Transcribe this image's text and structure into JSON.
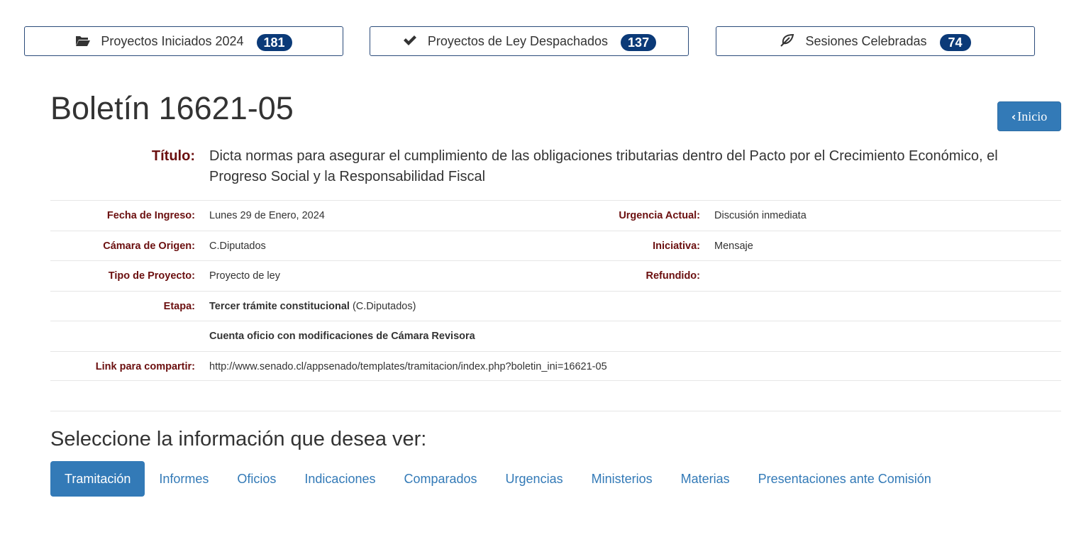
{
  "stats": [
    {
      "icon": "folder-open-icon",
      "label": "Proyectos Iniciados 2024",
      "count": "181"
    },
    {
      "icon": "checkmark-icon",
      "label": "Proyectos de Ley Despachados",
      "count": "137"
    },
    {
      "icon": "leaf-icon",
      "label": "Sesiones Celebradas",
      "count": "74"
    }
  ],
  "page_title": "Boletín 16621-05",
  "inicio_label": "Inicio",
  "titulo": {
    "label": "Título:",
    "text": "Dicta normas para asegurar el cumplimiento de las obligaciones tributarias dentro del Pacto por el Crecimiento Económico, el Progreso Social y la Responsabilidad Fiscal"
  },
  "info": {
    "fecha_ingreso": {
      "label": "Fecha de Ingreso:",
      "value": "Lunes 29 de Enero, 2024"
    },
    "urgencia_actual": {
      "label": "Urgencia Actual:",
      "value": "Discusión inmediata"
    },
    "camara_origen": {
      "label": "Cámara de Origen:",
      "value": "C.Diputados"
    },
    "iniciativa": {
      "label": "Iniciativa:",
      "value": "Mensaje"
    },
    "tipo_proyecto": {
      "label": "Tipo de Proyecto:",
      "value": "Proyecto de ley"
    },
    "refundido": {
      "label": "Refundido:",
      "value": ""
    },
    "etapa": {
      "label": "Etapa:",
      "value_bold": "Tercer trámite constitucional",
      "value_rest": " (C.Diputados)"
    },
    "subetapa": {
      "value": "Cuenta oficio con modificaciones de Cámara Revisora"
    },
    "link": {
      "label": "Link para compartir:",
      "value": "http://www.senado.cl/appsenado/templates/tramitacion/index.php?boletin_ini=16621-05"
    }
  },
  "section_title": "Seleccione la información que desea ver:",
  "tabs": [
    {
      "label": "Tramitación",
      "active": true
    },
    {
      "label": "Informes"
    },
    {
      "label": "Oficios"
    },
    {
      "label": "Indicaciones"
    },
    {
      "label": "Comparados"
    },
    {
      "label": "Urgencias"
    },
    {
      "label": "Ministerios"
    },
    {
      "label": "Materias"
    },
    {
      "label": "Presentaciones ante Comisión"
    }
  ],
  "colors": {
    "label": "#6b0f0f",
    "badge": "#0b3a78",
    "primary": "#337ab7"
  }
}
